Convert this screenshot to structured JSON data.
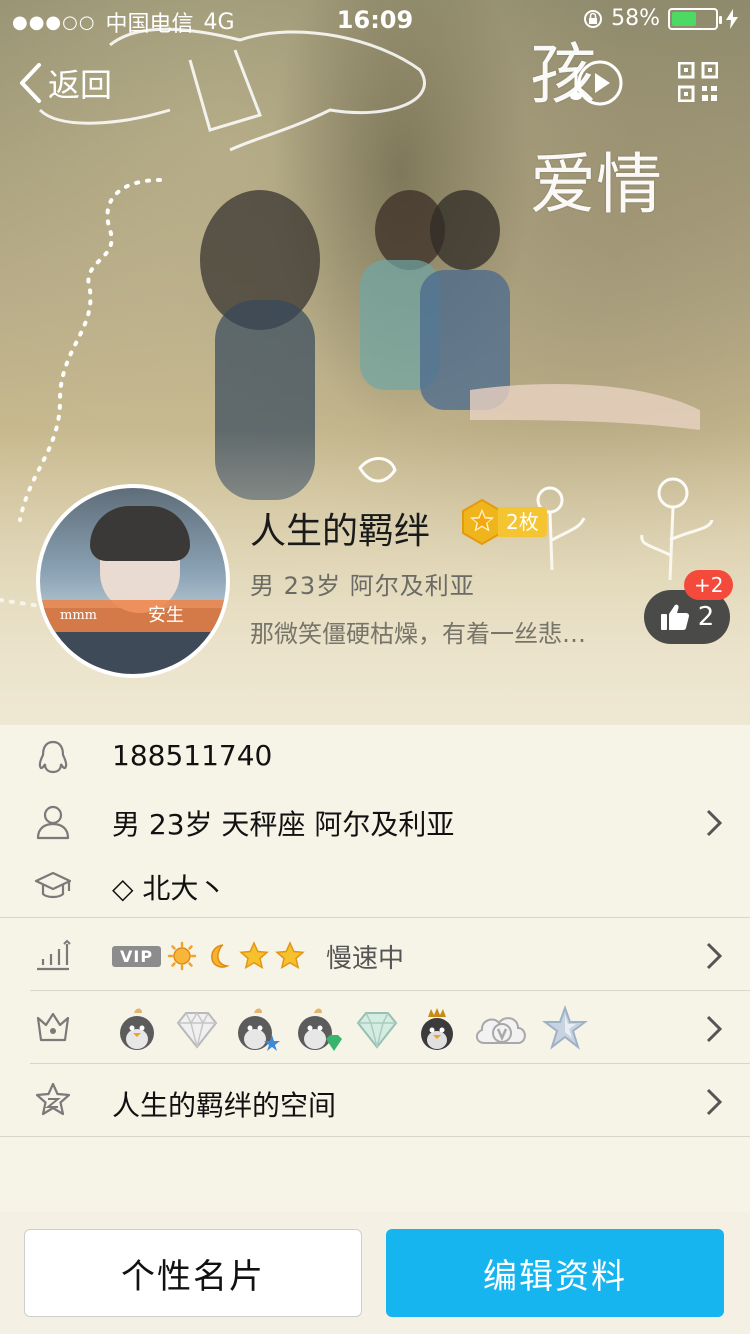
{
  "status_bar": {
    "signal": "●●●○○",
    "carrier": "中国电信",
    "network": "4G",
    "time": "16:09",
    "battery_percent": "58%",
    "battery_level": 0.58
  },
  "nav": {
    "back_label": "返回"
  },
  "cover": {
    "art_text_line1": "孩",
    "art_text_line2": "爱情"
  },
  "profile": {
    "nickname": "人生的羁绊",
    "badge_count": "2枚",
    "basic_info": "男  23岁  阿尔及利亚",
    "signature": "那微笑僵硬枯燥，有着一丝悲…",
    "avatar_band_left": "mmm",
    "avatar_band_right": "安生",
    "likes": "2",
    "likes_new": "+2"
  },
  "info_list": {
    "qq_number": "188511740",
    "personal": "男 23岁 天秤座 阿尔及利亚",
    "school": "◇ 北大丶",
    "level": {
      "vip_tag": "VIP",
      "level_icons": [
        "sun-icon",
        "moon-icon",
        "star-icon",
        "star-icon"
      ],
      "speed": "慢速中"
    },
    "medals": [
      "penguin-medal-icon",
      "diamond-medal-icon",
      "penguin-star-medal-icon",
      "penguin-diamond-medal-icon",
      "green-diamond-medal-icon",
      "crown-penguin-medal-icon",
      "cloud-v-medal-icon",
      "star-medal-icon"
    ],
    "space": "人生的羁绊的空间"
  },
  "bottom": {
    "card_button": "个性名片",
    "edit_button": "编辑资料"
  },
  "colors": {
    "primary_blue": "#16b5ef",
    "like_red": "#f44a3b",
    "badge_gold": "#f5c431"
  }
}
